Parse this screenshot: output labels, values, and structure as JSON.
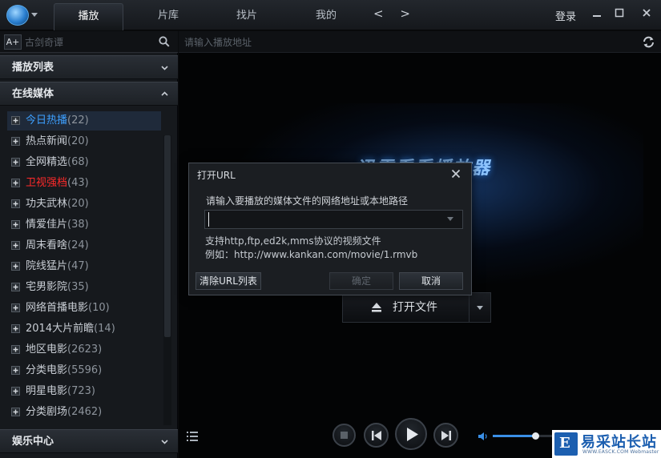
{
  "titlebar": {
    "tabs": [
      "播放",
      "片库",
      "找片",
      "我的"
    ],
    "nav_arrows": "< >",
    "login": "登录"
  },
  "sidebar": {
    "font_button": "A+",
    "search_placeholder": "古剑奇谭",
    "sections": {
      "playlist": "播放列表",
      "online_media": "在线媒体",
      "entertainment": "娱乐中心"
    },
    "items": [
      {
        "label": "今日热播",
        "count": "(22)",
        "selected": true
      },
      {
        "label": "热点新闻",
        "count": "(20)"
      },
      {
        "label": "全网精选",
        "count": "(68)"
      },
      {
        "label": "卫视强档",
        "count": "(43)",
        "highlight": "#ff2a2a"
      },
      {
        "label": "功夫武林",
        "count": "(20)"
      },
      {
        "label": "情爱佳片",
        "count": "(38)"
      },
      {
        "label": "周末看啥",
        "count": "(24)"
      },
      {
        "label": "院线猛片",
        "count": "(47)"
      },
      {
        "label": "宅男影院",
        "count": "(35)"
      },
      {
        "label": "网络首播电影",
        "count": "(10)"
      },
      {
        "label": "2014大片前瞻",
        "count": "(14)"
      },
      {
        "label": "地区电影",
        "count": "(2623)"
      },
      {
        "label": "分类电影",
        "count": "(5596)"
      },
      {
        "label": "明星电影",
        "count": "(723)"
      },
      {
        "label": "分类剧场",
        "count": "(2462)"
      }
    ]
  },
  "main": {
    "url_placeholder": "请输入播放地址",
    "brand_text": "迅雷看看播放器",
    "open_file": "打开文件",
    "volume_level": 0.48
  },
  "dialog": {
    "title": "打开URL",
    "prompt": "请输入要播放的媒体文件的网络地址或本地路径",
    "input_value": "",
    "hint_line1": "支持http,ftp,ed2k,mms协议的视频文件",
    "hint_line2": "例如：http://www.kankan.com/movie/1.rmvb",
    "clear_button": "清除URL列表",
    "ok_button": "确定",
    "cancel_button": "取消"
  },
  "watermark": {
    "mark": "E",
    "text": "易采站长站",
    "sub": "WWW.EASCK.COM Webmaster"
  },
  "colors": {
    "accent": "#3da0ff",
    "highlight_red": "#ff2a2a",
    "background": "#0a0b0d"
  }
}
